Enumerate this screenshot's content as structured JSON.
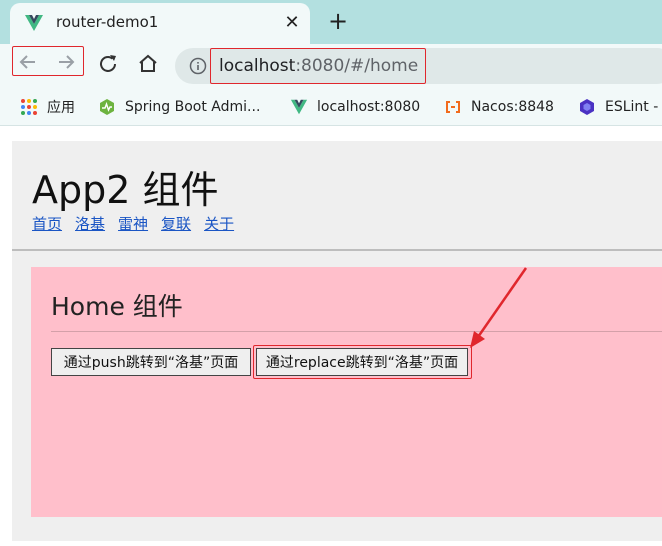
{
  "browser": {
    "tab": {
      "title": "router-demo1",
      "close_glyph": "✕"
    },
    "new_tab_glyph": "+",
    "url": {
      "host": "localhost",
      "rest": ":8080/#/home"
    },
    "bookmarks": [
      {
        "label": "应用",
        "icon": "apps-grid-icon"
      },
      {
        "label": "Spring Boot Admi...",
        "icon": "spring-boot-admin-icon"
      },
      {
        "label": "localhost:8080",
        "icon": "vue-logo-icon"
      },
      {
        "label": "Nacos:8848",
        "icon": "nacos-icon"
      },
      {
        "label": "ESLint -",
        "icon": "eslint-icon"
      }
    ]
  },
  "app": {
    "title": "App2 组件",
    "nav": [
      "首页",
      "洛基",
      "雷神",
      "复联",
      "关于"
    ],
    "home": {
      "title": "Home 组件",
      "push_button": "通过push跳转到“洛基”页面",
      "replace_button": "通过replace跳转到“洛基”页面"
    }
  },
  "colors": {
    "annotation_red": "#e0272d",
    "home_panel_bg": "#ffbfcb",
    "link_blue": "#1a55c4",
    "tabstrip_bg": "#b3e0e0"
  }
}
